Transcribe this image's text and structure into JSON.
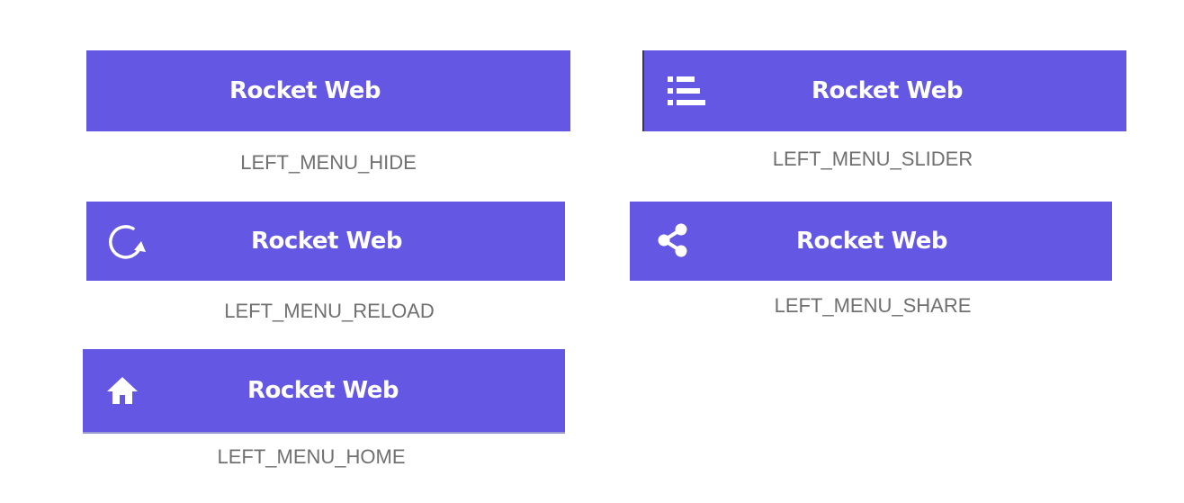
{
  "colors": {
    "toolbar_background": "#6457e4",
    "toolbar_text": "#ffffff",
    "caption_text": "#707070"
  },
  "variants": {
    "hide": {
      "title": "Rocket Web",
      "caption": "LEFT_MENU_HIDE",
      "icon": "none"
    },
    "slider": {
      "title": "Rocket Web",
      "caption": "LEFT_MENU_SLIDER",
      "icon": "menu-list-icon"
    },
    "reload": {
      "title": "Rocket Web",
      "caption": "LEFT_MENU_RELOAD",
      "icon": "reload-icon"
    },
    "share": {
      "title": "Rocket Web",
      "caption": "LEFT_MENU_SHARE",
      "icon": "share-icon"
    },
    "home": {
      "title": "Rocket Web",
      "caption": "LEFT_MENU_HOME",
      "icon": "home-icon"
    }
  }
}
